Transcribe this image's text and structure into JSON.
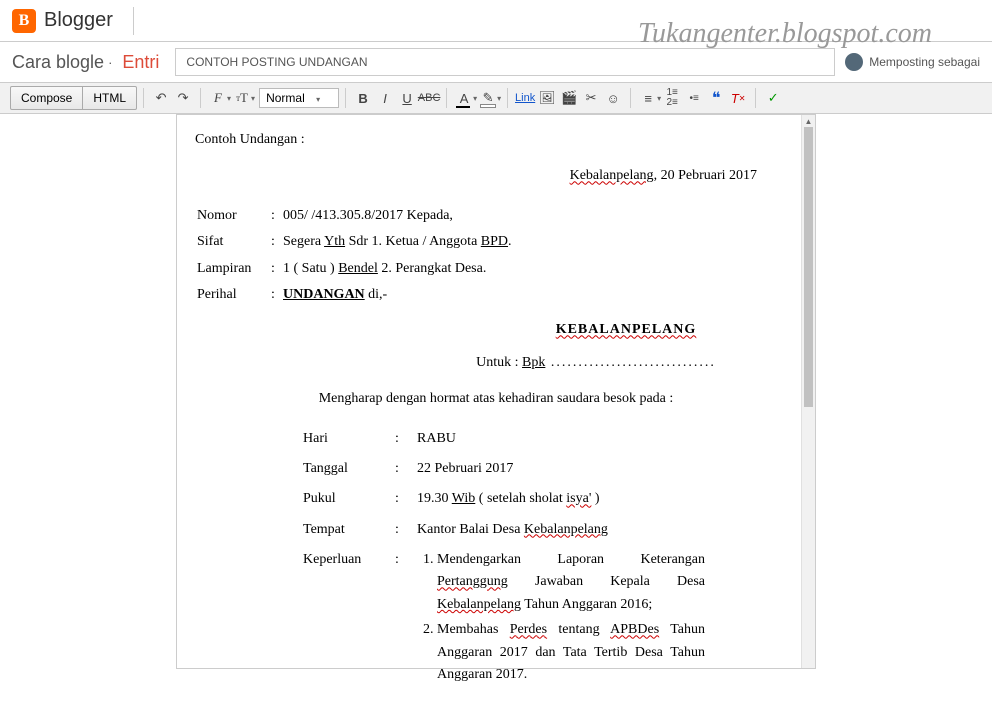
{
  "header": {
    "brand": "Blogger"
  },
  "watermark": "Tukangenter.blogspot.com",
  "titleRow": {
    "blogName": "Cara blogle",
    "section": "Entri",
    "postTitle": "CONTOH POSTING UNDANGAN",
    "userStatus": "Memposting sebagai"
  },
  "toolbar": {
    "compose": "Compose",
    "html": "HTML",
    "format": "Normal",
    "link": "Link"
  },
  "doc": {
    "heading": "Contoh Undangan :",
    "placeDate": {
      "place": "Kebalanpelang",
      "date": ", 20 Pebruari 2017"
    },
    "meta": {
      "nomorLabel": "Nomor",
      "nomor": "005/ /413.305.8/2017 Kepada,",
      "sifatLabel": "Sifat",
      "sifatPre": "Segera ",
      "sifatYth": "Yth",
      "sifatMid": " Sdr 1. Ketua / Anggota ",
      "sifatBpd": "BPD",
      "sifatEnd": ".",
      "lampiranLabel": "Lampiran",
      "lampiranPre": "1 ( Satu ) ",
      "lampiranBendel": "Bendel",
      "lampiranEnd": " 2. Perangkat Desa.",
      "perihalLabel": "Perihal",
      "perihal": "UNDANGAN",
      "perihalEnd": " di,-"
    },
    "kota": "KEBALANPELANG",
    "untukLabel": "Untuk : ",
    "untukBpk": "Bpk",
    "dots": " ..............................",
    "intro": "Mengharap dengan hormat atas kehadiran saudara besok pada :",
    "tbl": {
      "hariL": "Hari",
      "hari": "RABU",
      "tglL": "Tanggal",
      "tgl": "22 Pebruari 2017",
      "pukulL": "Pukul",
      "pukulA": "19.30 ",
      "pukulWib": "Wib",
      "pukulB": " ( setelah sholat ",
      "pukulIsya": "isya'",
      "pukulC": " )",
      "tempatL": "Tempat",
      "tempatA": "Kantor Balai Desa ",
      "tempatB": "Kebalanpelang",
      "keperluanL": "Keperluan",
      "kp1a": "Mendengarkan Laporan Keterangan ",
      "kp1b": "Pertanggung",
      "kp1c": " Jawaban Kepala Desa ",
      "kp1d": "Kebalanpelang",
      "kp1e": " Tahun Anggaran 2016;",
      "kp2a": "Membahas ",
      "kp2b": "Perdes",
      "kp2c": " tentang ",
      "kp2d": "APBDes",
      "kp2e": " Tahun Anggaran 2017 dan Tata Tertib Desa Tahun Anggaran 2017."
    }
  }
}
